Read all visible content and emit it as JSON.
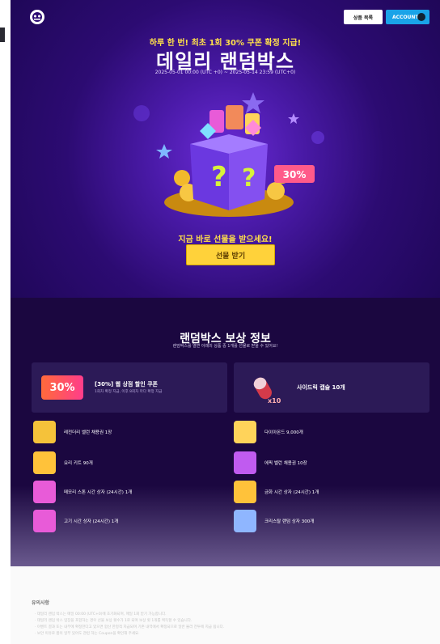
{
  "header": {
    "products_button": "상품 목록",
    "account_button": "ACCOUNT"
  },
  "hero": {
    "subtitle": "하루 한 번! 최초 1회 30% 쿠폰 확정 지급!",
    "title": "데일리 랜덤박스",
    "period": "2025-05-01 00:00 (UTC +0) ~ 2025-05-14 23:59 (UTC+0)",
    "badge": "30%",
    "cta_text": "지금 바로 선물을 받으세요!",
    "cta_button": "선물 받기"
  },
  "rewards": {
    "title": "랜덤박스 보상 정보",
    "description": "랜덤박스를 열면 아래의 상품 중 1개를 선물로 받을 수 있어요!",
    "featured": [
      {
        "title": "[30%] 웹 상점 할인 쿠폰",
        "subtitle": "1회차 확정 지급, 이후 8회차 마다 확정 지급",
        "badge": "30%"
      },
      {
        "title": "사이드릭 캡슐 10개",
        "badge": "x10"
      }
    ],
    "items": [
      {
        "label": "레전더리 벨런 채용권 1장",
        "icon": "card-icon",
        "color": "#f5c23a"
      },
      {
        "label": "다이아몬드 9,000개",
        "icon": "diamond-icon",
        "color": "#ffd35a"
      },
      {
        "label": "요리 키트 90개",
        "icon": "cooking-kit-icon",
        "color": "#ffc23a"
      },
      {
        "label": "에픽 벨런 채용권 10장",
        "icon": "epic-card-icon",
        "color": "#c05bf0"
      },
      {
        "label": "메모리 스톤 시간 상자 (24시간) 1개",
        "icon": "memory-stone-box-icon",
        "color": "#e85bd8"
      },
      {
        "label": "금화 시간 상자 (24시간) 1개",
        "icon": "gold-box-icon",
        "color": "#ffc23a"
      },
      {
        "label": "고기 시간 상자 (24시간) 1개",
        "icon": "meat-box-icon",
        "color": "#e85bd8"
      },
      {
        "label": "크리스탈 랜덤 상자 300개",
        "icon": "crystal-box-icon",
        "color": "#8fb6ff"
      }
    ]
  },
  "notice": {
    "heading": "유의사항",
    "lines": [
      "· 데일리 랜덤 박스는 매일 00:00 (UTC+0)에 초기화되며, 매일 1회 받기 가능합니다.",
      "· 데일리 랜덤 박스 입장을 포함하는 경우 선물 보상 횟수가 1로 되며 보상 횟 1개를 획득할 수 있습니다.",
      "· 이벤트 결과 또는 내부에 확정한다고 있으면 합산 한정적 지급되며 기존 내역에서 확정되므로 일반 불러 전투에 지급 됩니다.",
      "· 보안 이유로 폼이 일부 있어도 관련 하는 Coupon을 확인해 주세요."
    ]
  }
}
